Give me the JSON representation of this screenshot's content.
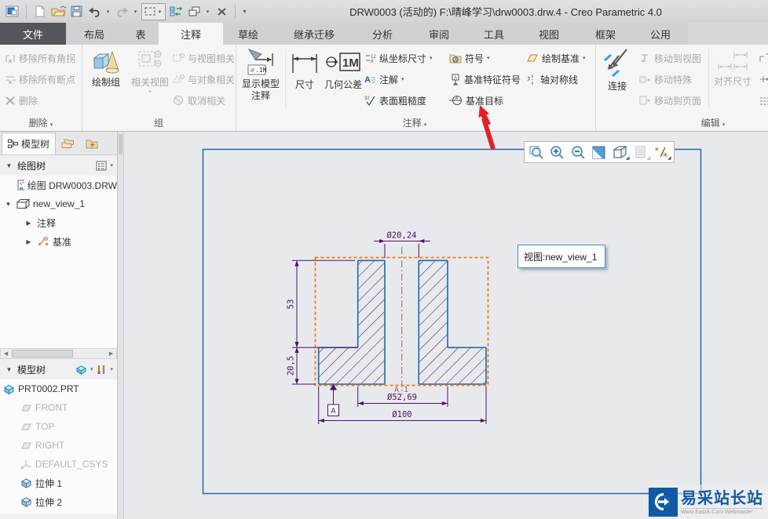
{
  "window": {
    "title": "DRW0003 (活动的) F:\\晴峰学习\\drw0003.drw.4 - Creo Parametric 4.0"
  },
  "quick_access_icons": [
    "window",
    "new-file",
    "open-folder",
    "save",
    "undo",
    "redo",
    "select-box",
    "regenerate",
    "windows",
    "close",
    "more"
  ],
  "tabs": {
    "file": "文件",
    "items": [
      "布局",
      "表",
      "注释",
      "草绘",
      "继承迁移",
      "分析",
      "审阅",
      "工具",
      "视图",
      "框架",
      "公用"
    ],
    "active": "注释"
  },
  "ribbon": {
    "groups": {
      "delete": {
        "label": "删除",
        "remove_jogs": "移除所有角拐",
        "remove_breaks": "移除所有断点",
        "delete": "删除"
      },
      "group": {
        "label": "组",
        "draw_group": "绘制组",
        "related_view": "相关视图",
        "relate_to_view": "与视图相关",
        "relate_to_object": "与对象相关",
        "unrelate": "取消相关"
      },
      "annotate": {
        "label": "注释",
        "show_model_annotations_l1": "显示模型",
        "show_model_annotations_l2": "注释",
        "dimension": "尺寸",
        "gtol": "几何公差",
        "ordinate_dimension": "纵坐标尺寸",
        "note": "注解",
        "surface_finish": "表面粗糙度",
        "symbol": "符号",
        "datum_feature_symbol": "基准特征符号",
        "datum_target": "基准目标",
        "draw_datum": "绘制基准",
        "symmetry_line": "轴对称线"
      },
      "edit": {
        "label": "编辑",
        "connect": "连接",
        "move_to_view": "移动到视图",
        "move_special": "移动特殊",
        "move_to_sheet": "移动到页面",
        "align_dimensions": "对齐尺寸"
      }
    }
  },
  "panel": {
    "model_tree_tab": "模型树",
    "drawing_tree": {
      "header": "绘图树",
      "drawing": "绘图 DRW0003.DRW",
      "view": "new_view_1",
      "annotations": "注释",
      "datums": "基准"
    },
    "model_tree": {
      "header": "模型树",
      "part": "PRT0002.PRT",
      "front": "FRONT",
      "top": "TOP",
      "right": "RIGHT",
      "csys": "DEFAULT_CSYS",
      "extrude1": "拉伸 1",
      "extrude2": "拉伸 2"
    }
  },
  "canvas": {
    "view_tooltip": "视图:new_view_1",
    "mini_toolbar_icons": [
      "zoom-box",
      "zoom-in",
      "zoom-out",
      "repaint",
      "saved-views",
      "sheets",
      "datum-display"
    ],
    "drawing": {
      "dim_hole": "Ø20,24",
      "dim_boss_height": "53",
      "dim_flange_height": "20,5",
      "dim_boss_dia": "Ø52,69",
      "dim_flange_dia": "Ø100",
      "axis": "A_1",
      "datum": "A"
    }
  },
  "watermark": {
    "title": "易采站长站",
    "subtitle": "Www.Easck.Com Webmaster"
  },
  "colors": {
    "outline_blue": "#1a6ab0",
    "hatch_purple": "#4a1259",
    "dimension_purple": "#471566",
    "centerline_brown": "#8d6e5c",
    "selection_orange": "#ee7b17",
    "sheet_border": "#2a6cad",
    "arrow_red": "#e02125",
    "brand_blue": "#1159a4"
  }
}
